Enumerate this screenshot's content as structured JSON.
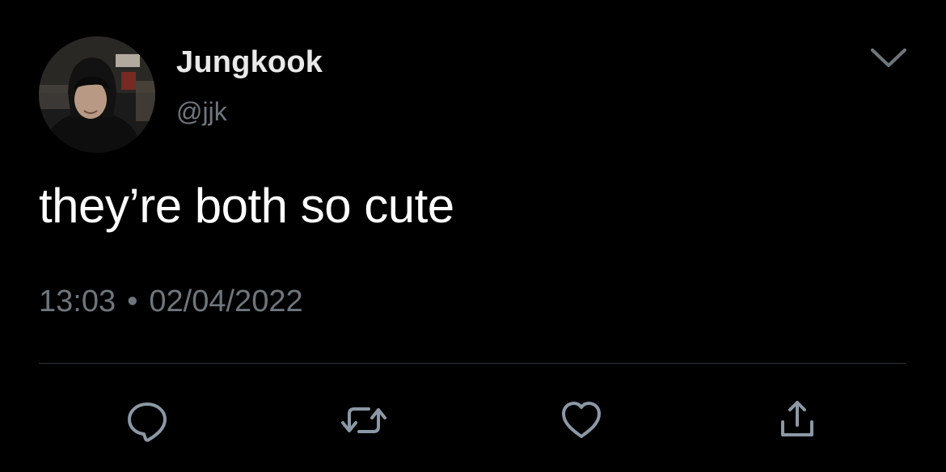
{
  "tweet": {
    "display_name": "Jungkook",
    "handle": "@jjk",
    "text": "they’re both so cute",
    "time": "13:03",
    "separator": "•",
    "date": "02/04/2022"
  },
  "actions": {
    "reply_icon": "reply-bubble-icon",
    "retweet_icon": "retweet-icon",
    "like_icon": "heart-icon",
    "share_icon": "share-icon",
    "menu_icon": "chevron-down-icon"
  },
  "colors": {
    "background": "#000000",
    "primary_text": "#ffffff",
    "secondary_text": "#6e767d",
    "divider": "#2f3336"
  }
}
